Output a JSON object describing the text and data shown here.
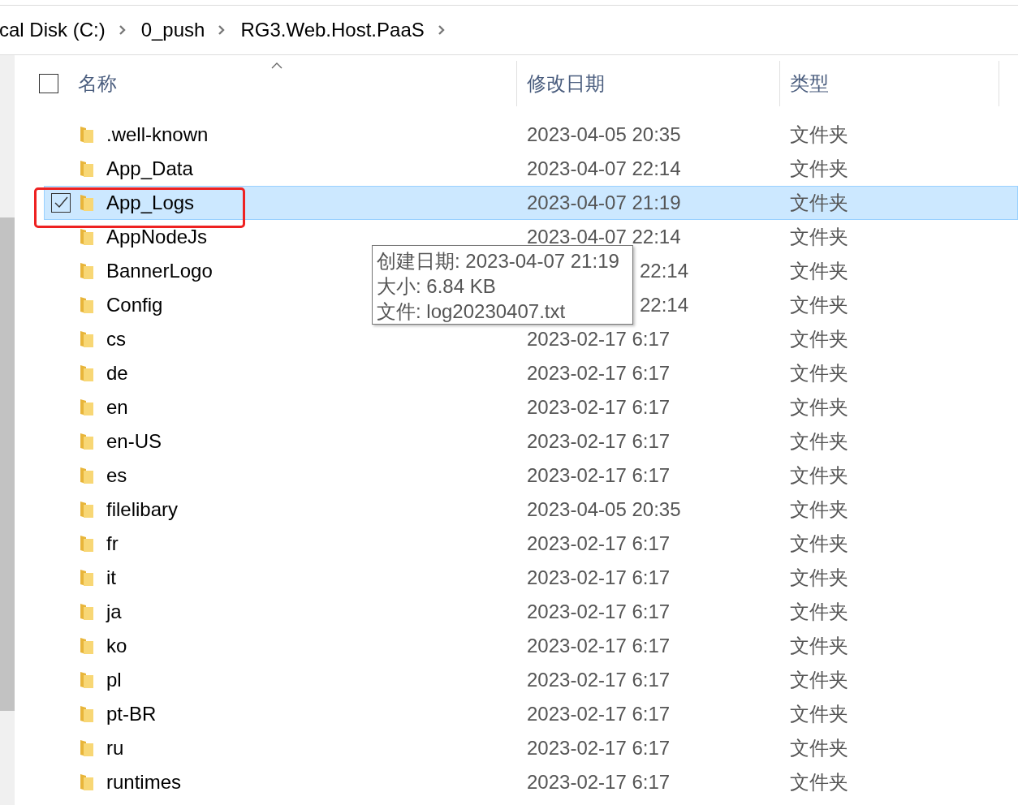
{
  "breadcrumb": [
    "cal Disk (C:)",
    "0_push",
    "RG3.Web.Host.PaaS"
  ],
  "table": {
    "select_all_checked": false,
    "columns": [
      "名称",
      "修改日期",
      "类型"
    ],
    "rows": [
      {
        "name": ".well-known",
        "date": "2023-04-05 20:35",
        "type": "文件夹",
        "selected": false,
        "checked": false
      },
      {
        "name": "App_Data",
        "date": "2023-04-07 22:14",
        "type": "文件夹",
        "selected": false,
        "checked": false
      },
      {
        "name": "App_Logs",
        "date": "2023-04-07 21:19",
        "type": "文件夹",
        "selected": true,
        "checked": true
      },
      {
        "name": "AppNodeJs",
        "date": "2023-04-07 22:14",
        "type": "文件夹",
        "selected": false,
        "checked": false
      },
      {
        "name": "BannerLogo",
        "date": "22:14",
        "date_partly_covered": true,
        "type": "文件夹",
        "selected": false,
        "checked": false
      },
      {
        "name": "Config",
        "date": "22:14",
        "date_partly_covered": true,
        "type": "文件夹",
        "selected": false,
        "checked": false
      },
      {
        "name": "cs",
        "date": "2023-02-17 6:17",
        "type": "文件夹",
        "selected": false,
        "checked": false
      },
      {
        "name": "de",
        "date": "2023-02-17 6:17",
        "type": "文件夹",
        "selected": false,
        "checked": false
      },
      {
        "name": "en",
        "date": "2023-02-17 6:17",
        "type": "文件夹",
        "selected": false,
        "checked": false
      },
      {
        "name": "en-US",
        "date": "2023-02-17 6:17",
        "type": "文件夹",
        "selected": false,
        "checked": false
      },
      {
        "name": "es",
        "date": "2023-02-17 6:17",
        "type": "文件夹",
        "selected": false,
        "checked": false
      },
      {
        "name": "filelibary",
        "date": "2023-04-05 20:35",
        "type": "文件夹",
        "selected": false,
        "checked": false
      },
      {
        "name": "fr",
        "date": "2023-02-17 6:17",
        "type": "文件夹",
        "selected": false,
        "checked": false
      },
      {
        "name": "it",
        "date": "2023-02-17 6:17",
        "type": "文件夹",
        "selected": false,
        "checked": false
      },
      {
        "name": "ja",
        "date": "2023-02-17 6:17",
        "type": "文件夹",
        "selected": false,
        "checked": false
      },
      {
        "name": "ko",
        "date": "2023-02-17 6:17",
        "type": "文件夹",
        "selected": false,
        "checked": false
      },
      {
        "name": "pl",
        "date": "2023-02-17 6:17",
        "type": "文件夹",
        "selected": false,
        "checked": false
      },
      {
        "name": "pt-BR",
        "date": "2023-02-17 6:17",
        "type": "文件夹",
        "selected": false,
        "checked": false
      },
      {
        "name": "ru",
        "date": "2023-02-17 6:17",
        "type": "文件夹",
        "selected": false,
        "checked": false
      },
      {
        "name": "runtimes",
        "date": "2023-02-17 6:17",
        "type": "文件夹",
        "selected": false,
        "checked": false
      }
    ]
  },
  "tooltip": [
    "创建日期: 2023-04-07 21:19",
    "大小: 6.84 KB",
    "文件: log20230407.txt"
  ]
}
